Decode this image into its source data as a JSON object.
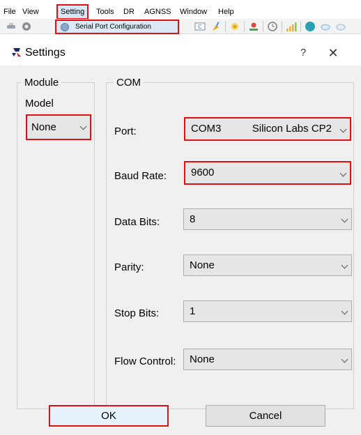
{
  "menubar": {
    "items": [
      "File",
      "View",
      "Setting",
      "Tools",
      "DR",
      "AGNSS",
      "Window",
      "Help"
    ]
  },
  "dropdown": {
    "item_label": "Serial Port Configuration"
  },
  "dialog": {
    "title": "Settings",
    "help_symbol": "?",
    "close_symbol": "✕"
  },
  "module": {
    "group_title": "Module",
    "model_label": "Model",
    "model_value": "None"
  },
  "com": {
    "group_title": "COM",
    "port_label": "Port:",
    "port_value": "COM3",
    "port_description": "Silicon Labs CP2",
    "baud_label": "Baud Rate:",
    "baud_value": "9600",
    "data_bits_label": "Data Bits:",
    "data_bits_value": "8",
    "parity_label": "Parity:",
    "parity_value": "None",
    "stop_bits_label": "Stop Bits:",
    "stop_bits_value": "1",
    "flow_label": "Flow Control:",
    "flow_value": "None"
  },
  "footer": {
    "ok_label": "OK",
    "cancel_label": "Cancel"
  },
  "colors": {
    "highlight": "#e01010",
    "dialog_bg": "#f0f0f0"
  }
}
